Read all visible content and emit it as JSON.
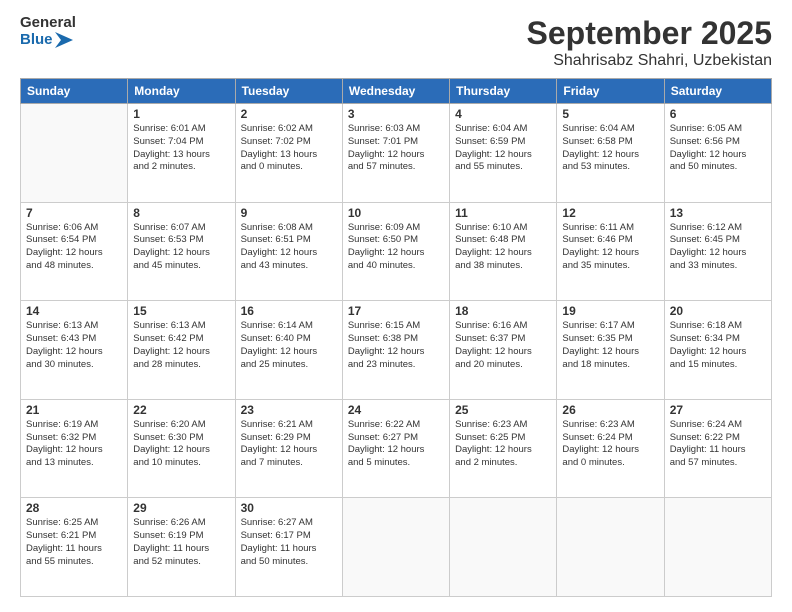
{
  "header": {
    "logo_general": "General",
    "logo_blue": "Blue",
    "month_title": "September 2025",
    "location": "Shahrisabz Shahri, Uzbekistan"
  },
  "weekdays": [
    "Sunday",
    "Monday",
    "Tuesday",
    "Wednesday",
    "Thursday",
    "Friday",
    "Saturday"
  ],
  "weeks": [
    [
      {
        "day": "",
        "info": ""
      },
      {
        "day": "1",
        "info": "Sunrise: 6:01 AM\nSunset: 7:04 PM\nDaylight: 13 hours\nand 2 minutes."
      },
      {
        "day": "2",
        "info": "Sunrise: 6:02 AM\nSunset: 7:02 PM\nDaylight: 13 hours\nand 0 minutes."
      },
      {
        "day": "3",
        "info": "Sunrise: 6:03 AM\nSunset: 7:01 PM\nDaylight: 12 hours\nand 57 minutes."
      },
      {
        "day": "4",
        "info": "Sunrise: 6:04 AM\nSunset: 6:59 PM\nDaylight: 12 hours\nand 55 minutes."
      },
      {
        "day": "5",
        "info": "Sunrise: 6:04 AM\nSunset: 6:58 PM\nDaylight: 12 hours\nand 53 minutes."
      },
      {
        "day": "6",
        "info": "Sunrise: 6:05 AM\nSunset: 6:56 PM\nDaylight: 12 hours\nand 50 minutes."
      }
    ],
    [
      {
        "day": "7",
        "info": "Sunrise: 6:06 AM\nSunset: 6:54 PM\nDaylight: 12 hours\nand 48 minutes."
      },
      {
        "day": "8",
        "info": "Sunrise: 6:07 AM\nSunset: 6:53 PM\nDaylight: 12 hours\nand 45 minutes."
      },
      {
        "day": "9",
        "info": "Sunrise: 6:08 AM\nSunset: 6:51 PM\nDaylight: 12 hours\nand 43 minutes."
      },
      {
        "day": "10",
        "info": "Sunrise: 6:09 AM\nSunset: 6:50 PM\nDaylight: 12 hours\nand 40 minutes."
      },
      {
        "day": "11",
        "info": "Sunrise: 6:10 AM\nSunset: 6:48 PM\nDaylight: 12 hours\nand 38 minutes."
      },
      {
        "day": "12",
        "info": "Sunrise: 6:11 AM\nSunset: 6:46 PM\nDaylight: 12 hours\nand 35 minutes."
      },
      {
        "day": "13",
        "info": "Sunrise: 6:12 AM\nSunset: 6:45 PM\nDaylight: 12 hours\nand 33 minutes."
      }
    ],
    [
      {
        "day": "14",
        "info": "Sunrise: 6:13 AM\nSunset: 6:43 PM\nDaylight: 12 hours\nand 30 minutes."
      },
      {
        "day": "15",
        "info": "Sunrise: 6:13 AM\nSunset: 6:42 PM\nDaylight: 12 hours\nand 28 minutes."
      },
      {
        "day": "16",
        "info": "Sunrise: 6:14 AM\nSunset: 6:40 PM\nDaylight: 12 hours\nand 25 minutes."
      },
      {
        "day": "17",
        "info": "Sunrise: 6:15 AM\nSunset: 6:38 PM\nDaylight: 12 hours\nand 23 minutes."
      },
      {
        "day": "18",
        "info": "Sunrise: 6:16 AM\nSunset: 6:37 PM\nDaylight: 12 hours\nand 20 minutes."
      },
      {
        "day": "19",
        "info": "Sunrise: 6:17 AM\nSunset: 6:35 PM\nDaylight: 12 hours\nand 18 minutes."
      },
      {
        "day": "20",
        "info": "Sunrise: 6:18 AM\nSunset: 6:34 PM\nDaylight: 12 hours\nand 15 minutes."
      }
    ],
    [
      {
        "day": "21",
        "info": "Sunrise: 6:19 AM\nSunset: 6:32 PM\nDaylight: 12 hours\nand 13 minutes."
      },
      {
        "day": "22",
        "info": "Sunrise: 6:20 AM\nSunset: 6:30 PM\nDaylight: 12 hours\nand 10 minutes."
      },
      {
        "day": "23",
        "info": "Sunrise: 6:21 AM\nSunset: 6:29 PM\nDaylight: 12 hours\nand 7 minutes."
      },
      {
        "day": "24",
        "info": "Sunrise: 6:22 AM\nSunset: 6:27 PM\nDaylight: 12 hours\nand 5 minutes."
      },
      {
        "day": "25",
        "info": "Sunrise: 6:23 AM\nSunset: 6:25 PM\nDaylight: 12 hours\nand 2 minutes."
      },
      {
        "day": "26",
        "info": "Sunrise: 6:23 AM\nSunset: 6:24 PM\nDaylight: 12 hours\nand 0 minutes."
      },
      {
        "day": "27",
        "info": "Sunrise: 6:24 AM\nSunset: 6:22 PM\nDaylight: 11 hours\nand 57 minutes."
      }
    ],
    [
      {
        "day": "28",
        "info": "Sunrise: 6:25 AM\nSunset: 6:21 PM\nDaylight: 11 hours\nand 55 minutes."
      },
      {
        "day": "29",
        "info": "Sunrise: 6:26 AM\nSunset: 6:19 PM\nDaylight: 11 hours\nand 52 minutes."
      },
      {
        "day": "30",
        "info": "Sunrise: 6:27 AM\nSunset: 6:17 PM\nDaylight: 11 hours\nand 50 minutes."
      },
      {
        "day": "",
        "info": ""
      },
      {
        "day": "",
        "info": ""
      },
      {
        "day": "",
        "info": ""
      },
      {
        "day": "",
        "info": ""
      }
    ]
  ]
}
